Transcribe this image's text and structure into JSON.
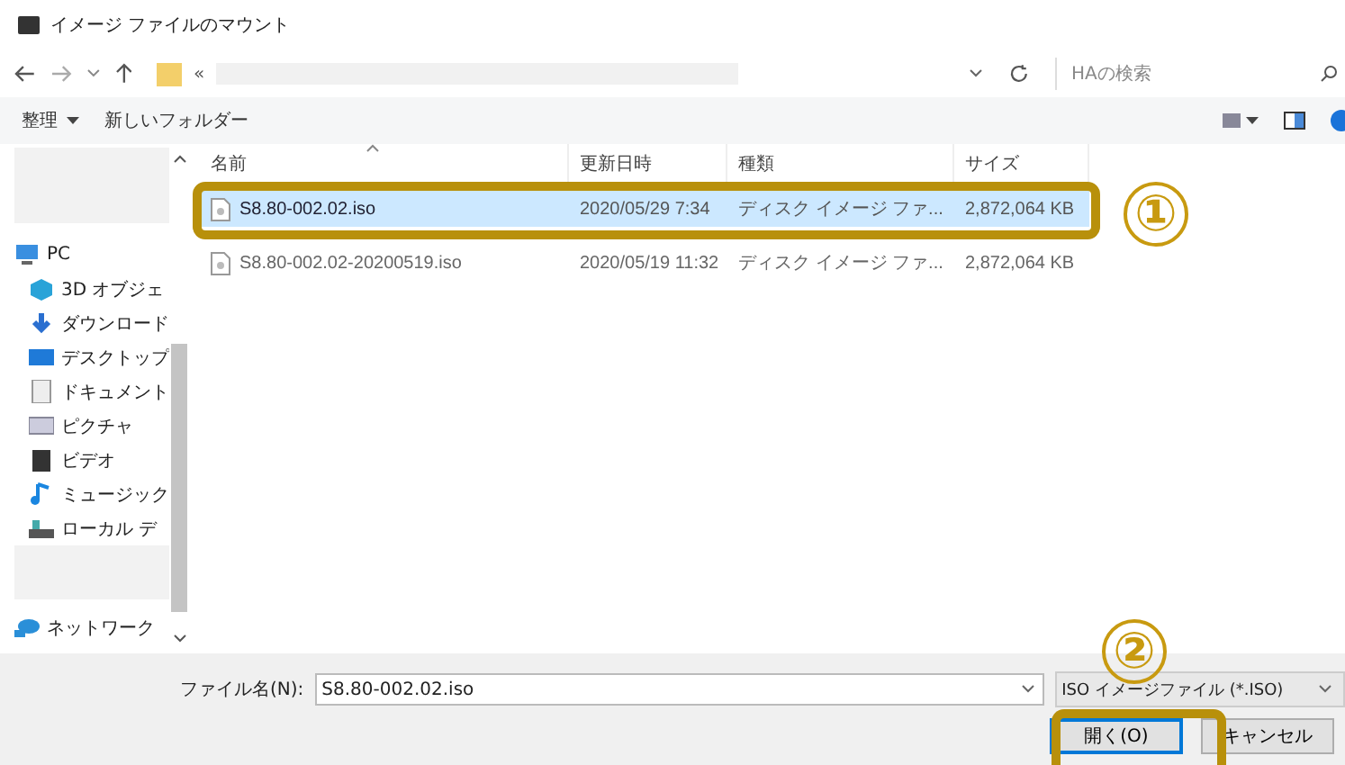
{
  "window": {
    "title": "イメージ ファイルのマウント"
  },
  "address_bar": {
    "path": "«",
    "search": {
      "placeholder": "HAの検索"
    }
  },
  "toolbar": {
    "organize": "整理",
    "new_folder": "新しいフォルダー"
  },
  "sidebar": {
    "items": [
      {
        "label": "PC",
        "children": [
          {
            "label": "3D オブジェ"
          },
          {
            "label": "ダウンロード"
          },
          {
            "label": "デスクトップ"
          },
          {
            "label": "ドキュメント"
          },
          {
            "label": "ピクチャ"
          },
          {
            "label": "ビデオ"
          },
          {
            "label": "ミュージック"
          },
          {
            "label": "ローカル デ"
          }
        ]
      },
      {
        "label": "ネットワーク"
      }
    ]
  },
  "table": {
    "columns": [
      {
        "label": "名前"
      },
      {
        "label": "更新日時"
      },
      {
        "label": "種類"
      },
      {
        "label": "サイズ"
      }
    ],
    "rows": [
      {
        "name": "S8.80-002.02.iso",
        "modified": "2020/05/29 7:34",
        "type": "ディスク イメージ ファ...",
        "size": "2,872,064 KB",
        "selected": true
      },
      {
        "name": "S8.80-002.02-20200519.iso",
        "modified": "2020/05/19 11:32",
        "type": "ディスク イメージ ファ...",
        "size": "2,872,064 KB",
        "selected": false
      }
    ]
  },
  "filename": {
    "label": "ファイル名(N):",
    "value": "S8.80-002.02.iso"
  },
  "file_type": {
    "value": "ISO イメージファイル (*.ISO)"
  },
  "buttons": [
    {
      "label": "開く(O)",
      "default": true
    },
    {
      "label": "キャンセル",
      "default": false
    }
  ],
  "annotations": [
    {
      "label": "①"
    },
    {
      "label": "②"
    }
  ]
}
